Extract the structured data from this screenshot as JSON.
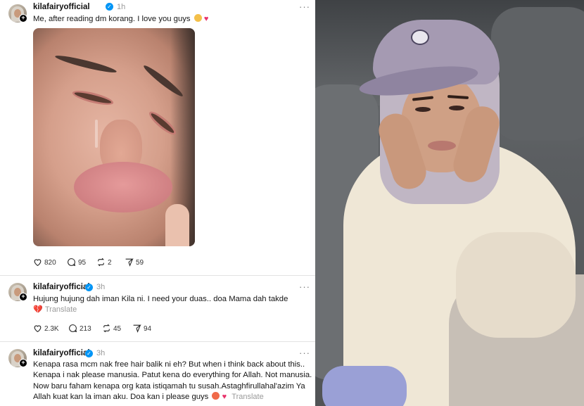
{
  "posts": [
    {
      "username": "kilafairyofficial",
      "time": "1h",
      "text_lines": [
        "Me, after reading dm korang. I love you guys"
      ],
      "translate_label": "",
      "stats": {
        "likes": "820",
        "replies": "95",
        "reposts": "2",
        "shares": "59"
      }
    },
    {
      "username": "kilafairyofficial",
      "time": "3h",
      "text_lines": [
        "Hujung hujung dah iman Kila ni. I need your duas.. doa Mama dah takde"
      ],
      "translate_label": "Translate",
      "stats": {
        "likes": "2.3K",
        "replies": "213",
        "reposts": "45",
        "shares": "94"
      }
    },
    {
      "username": "kilafairyofficial",
      "time": "3h",
      "text_lines": [
        "Kenapa rasa mcm nak free hair balik ni eh? But when i think back about this..",
        "Kenapa i nak please manusia. Patut kena do everything for Allah. Not manusia.",
        "Now baru faham kenapa org kata istiqamah tu susah.Astaghfirullahal'azim Ya",
        "Allah kuat kan la iman aku. Doa kan i please guys"
      ],
      "translate_label": "Translate",
      "stats": null
    }
  ],
  "icons": {
    "verified": "verified-badge-icon",
    "more": "more-options-icon",
    "like": "heart-icon",
    "reply": "comment-icon",
    "repost": "repost-icon",
    "share": "share-icon"
  },
  "colors": {
    "verified": "#0095f6",
    "heart_emoji": "#e8336b",
    "muted": "#999999"
  }
}
